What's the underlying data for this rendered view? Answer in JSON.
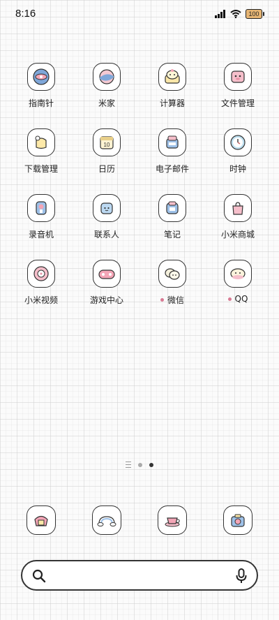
{
  "status_bar": {
    "time": "8:16",
    "battery_text": "100",
    "icons": [
      "signal-icon",
      "wifi-icon",
      "battery-icon"
    ]
  },
  "apps": [
    {
      "label": "指南针",
      "icon": "compass-icon",
      "dot": false
    },
    {
      "label": "米家",
      "icon": "mijia-icon",
      "dot": false
    },
    {
      "label": "计算器",
      "icon": "calculator-icon",
      "dot": false
    },
    {
      "label": "文件管理",
      "icon": "file-manager-icon",
      "dot": false
    },
    {
      "label": "下载管理",
      "icon": "download-manager-icon",
      "dot": false
    },
    {
      "label": "日历",
      "icon": "calendar-icon",
      "dot": false,
      "calendar_day": "10"
    },
    {
      "label": "电子邮件",
      "icon": "email-icon",
      "dot": false
    },
    {
      "label": "时钟",
      "icon": "clock-icon",
      "dot": false
    },
    {
      "label": "录音机",
      "icon": "recorder-icon",
      "dot": false
    },
    {
      "label": "联系人",
      "icon": "contacts-icon",
      "dot": false
    },
    {
      "label": "笔记",
      "icon": "notes-icon",
      "dot": false
    },
    {
      "label": "小米商城",
      "icon": "mi-store-icon",
      "dot": false
    },
    {
      "label": "小米视频",
      "icon": "mi-video-icon",
      "dot": false
    },
    {
      "label": "游戏中心",
      "icon": "game-center-icon",
      "dot": false
    },
    {
      "label": "微信",
      "icon": "wechat-icon",
      "dot": true
    },
    {
      "label": "QQ",
      "icon": "qq-icon",
      "dot": true
    }
  ],
  "page_indicator": {
    "pages": 2,
    "active_page": 2
  },
  "dock": [
    {
      "icon": "phone-icon"
    },
    {
      "icon": "messages-icon"
    },
    {
      "icon": "browser-icon"
    },
    {
      "icon": "camera-icon"
    }
  ],
  "search": {
    "search_icon": "search-icon",
    "mic_icon": "microphone-icon"
  },
  "colors": {
    "accent_pink": "#d97a94",
    "icon_outline": "#333333",
    "battery_fill": "#e6b574"
  }
}
